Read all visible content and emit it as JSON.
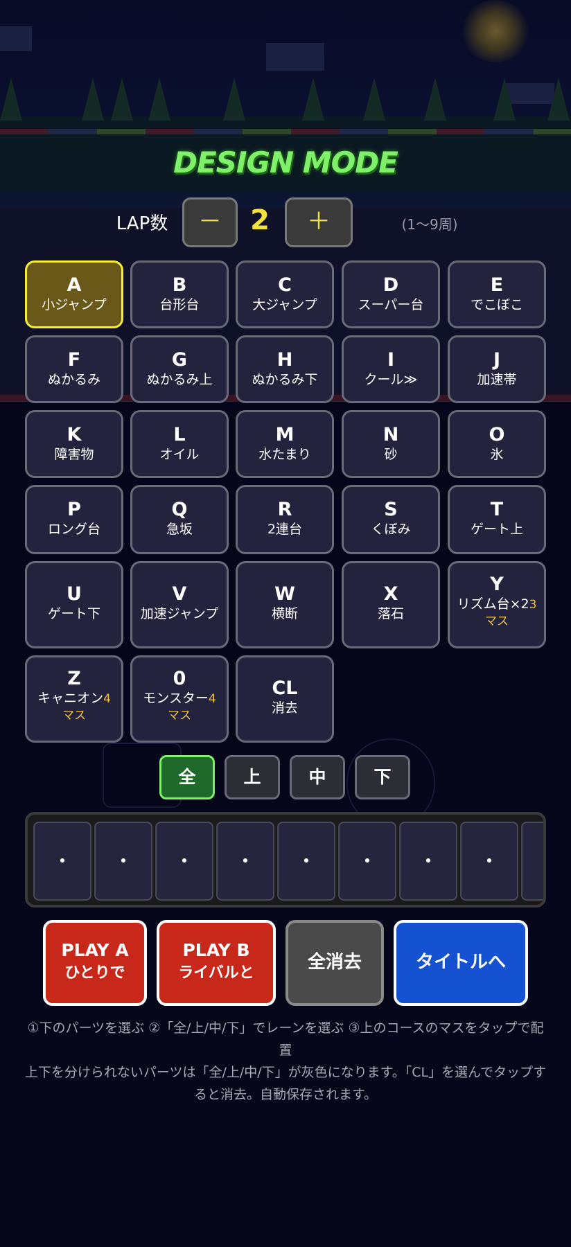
{
  "title": "DESIGN MODE",
  "lap": {
    "label": "LAP数",
    "minus_label": "－",
    "plus_label": "＋",
    "value": "2",
    "range_text": "(1〜9周)"
  },
  "parts": [
    {
      "key": "A",
      "name": "小ジャンプ",
      "selected": true
    },
    {
      "key": "B",
      "name": "台形台"
    },
    {
      "key": "C",
      "name": "大ジャンプ"
    },
    {
      "key": "D",
      "name": "スーパー台"
    },
    {
      "key": "E",
      "name": "でこぼこ"
    },
    {
      "key": "F",
      "name": "ぬかるみ"
    },
    {
      "key": "G",
      "name": "ぬかるみ上"
    },
    {
      "key": "H",
      "name": "ぬかるみ下"
    },
    {
      "key": "I",
      "name": "クール≫"
    },
    {
      "key": "J",
      "name": "加速帯"
    },
    {
      "key": "K",
      "name": "障害物"
    },
    {
      "key": "L",
      "name": "オイル"
    },
    {
      "key": "M",
      "name": "水たまり"
    },
    {
      "key": "N",
      "name": "砂"
    },
    {
      "key": "O",
      "name": "氷"
    },
    {
      "key": "P",
      "name": "ロング台"
    },
    {
      "key": "Q",
      "name": "急坂"
    },
    {
      "key": "R",
      "name": "2連台"
    },
    {
      "key": "S",
      "name": "くぼみ"
    },
    {
      "key": "T",
      "name": "ゲート上"
    },
    {
      "key": "U",
      "name": "ゲート下"
    },
    {
      "key": "V",
      "name": "加速ジャンプ"
    },
    {
      "key": "W",
      "name": "横断"
    },
    {
      "key": "X",
      "name": "落石"
    },
    {
      "key": "Y",
      "name": "リズム台×2",
      "size_num": "3",
      "size_unit": "マス"
    },
    {
      "key": "Z",
      "name": "キャニオン",
      "size_num": "4",
      "size_unit": "マス"
    },
    {
      "key": "0",
      "name": "モンスター",
      "size_num": "4",
      "size_unit": "マス"
    },
    {
      "key": "CL",
      "name": "消去"
    }
  ],
  "lanes": [
    {
      "label": "全",
      "active": true
    },
    {
      "label": "上"
    },
    {
      "label": "中"
    },
    {
      "label": "下"
    }
  ],
  "course_cells": [
    "・",
    "・",
    "・",
    "・",
    "・",
    "・",
    "・",
    "・",
    "・"
  ],
  "actions": {
    "play_a": {
      "line1": "PLAY A",
      "line2": "ひとりで"
    },
    "play_b": {
      "line1": "PLAY B",
      "line2": "ライバルと"
    },
    "clear_all": "全消去",
    "to_title": "タイトルへ"
  },
  "help": {
    "line1": "①下のパーツを選ぶ ②「全/上/中/下」でレーンを選ぶ ③上のコースのマスをタップで配置",
    "line2": "上下を分けられないパーツは「全/上/中/下」が灰色になります。「CL」を選んでタップすると消去。自動保存されます。"
  },
  "colors": {
    "accent_yellow": "#f5e23a",
    "title_green": "#7ef06a",
    "play_red": "#c8281a",
    "title_blue": "#1452d2"
  }
}
